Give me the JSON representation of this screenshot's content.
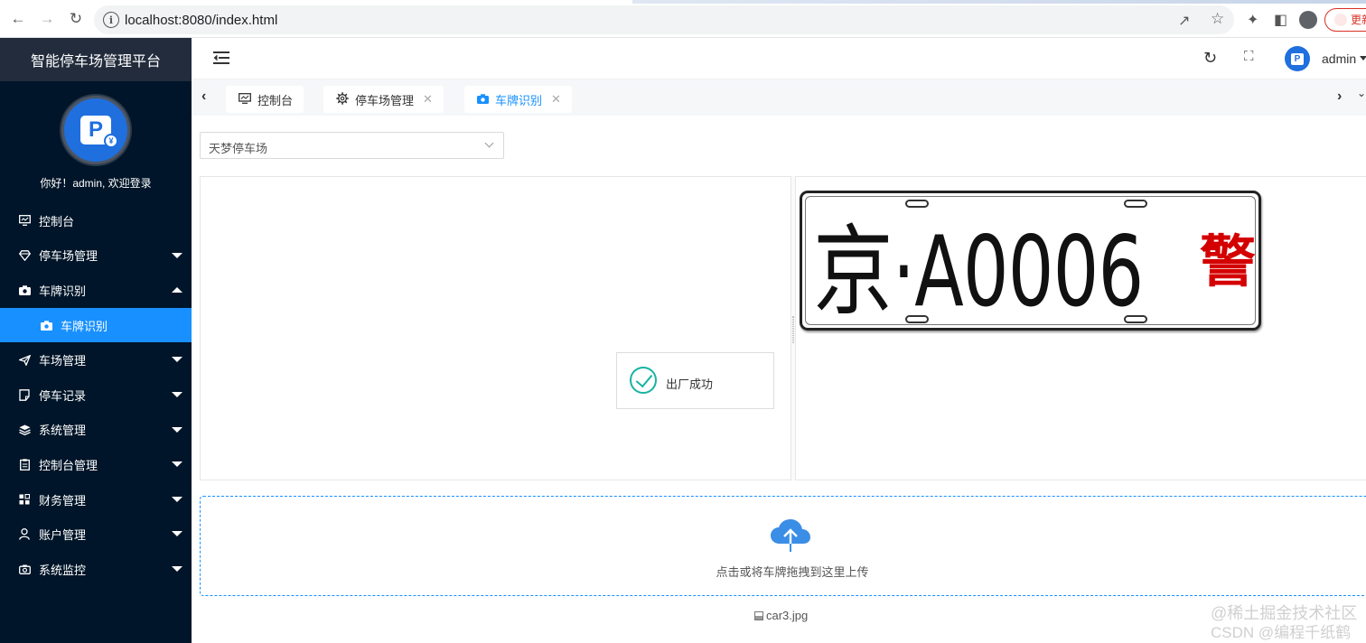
{
  "browser": {
    "url": "localhost:8080/index.html",
    "update_label": "更新"
  },
  "sidebar": {
    "app_title": "智能停车场管理平台",
    "welcome": "你好！admin, 欢迎登录",
    "items": [
      {
        "label": "控制台",
        "icon": "dashboard-icon",
        "expandable": false
      },
      {
        "label": "停车场管理",
        "icon": "diamond-icon",
        "expandable": true,
        "expanded": false
      },
      {
        "label": "车牌识别",
        "icon": "camera-icon",
        "expandable": true,
        "expanded": true
      },
      {
        "label": "车牌识别",
        "icon": "camera-icon",
        "sub": true,
        "active": true
      },
      {
        "label": "车场管理",
        "icon": "send-icon",
        "expandable": true,
        "expanded": false
      },
      {
        "label": "停车记录",
        "icon": "note-icon",
        "expandable": true,
        "expanded": false
      },
      {
        "label": "系统管理",
        "icon": "layers-icon",
        "expandable": true,
        "expanded": false
      },
      {
        "label": "控制台管理",
        "icon": "clipboard-icon",
        "expandable": true,
        "expanded": false
      },
      {
        "label": "财务管理",
        "icon": "grid-icon",
        "expandable": true,
        "expanded": false
      },
      {
        "label": "账户管理",
        "icon": "user-icon",
        "expandable": true,
        "expanded": false
      },
      {
        "label": "系统监控",
        "icon": "camera-outline-icon",
        "expandable": true,
        "expanded": false
      }
    ]
  },
  "header": {
    "username": "admin"
  },
  "tabs": [
    {
      "label": "控制台",
      "icon": "dashboard-icon",
      "closable": false,
      "active": false
    },
    {
      "label": "停车场管理",
      "icon": "gear-icon",
      "closable": true,
      "active": false
    },
    {
      "label": "车牌识别",
      "icon": "camera-icon",
      "closable": true,
      "active": true
    }
  ],
  "parking_select": {
    "value": "天梦停车场"
  },
  "toast": {
    "message": "出厂成功",
    "status_color": "#17b3a3"
  },
  "plate": {
    "text": "京·A0006",
    "suffix": "警",
    "suffix_color": "#d40000"
  },
  "upload": {
    "hint": "点击或将车牌拖拽到这里上传",
    "file_name": "car3.jpg"
  },
  "watermark": {
    "line1": "@稀土掘金技术社区",
    "line2": "CSDN @编程千纸鹤"
  },
  "colors": {
    "sidebar_bg": "#001529",
    "accent": "#1890ff"
  }
}
